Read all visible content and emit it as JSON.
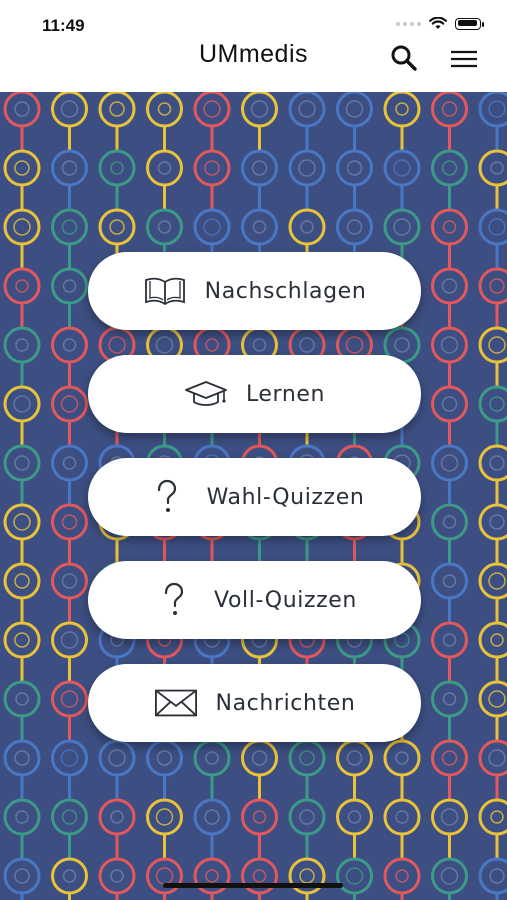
{
  "status_bar": {
    "time": "11:49"
  },
  "nav": {
    "title": "UMmedis"
  },
  "menu": [
    {
      "label": "Nachschlagen",
      "icon": "book-icon"
    },
    {
      "label": "Lernen",
      "icon": "graduation-cap-icon"
    },
    {
      "label": "Wahl-Quizzen",
      "icon": "question-mark-icon"
    },
    {
      "label": "Voll-Quizzen",
      "icon": "question-mark-icon"
    },
    {
      "label": "Nachrichten",
      "icon": "envelope-icon"
    }
  ],
  "colors": {
    "pattern_background": "#3d4f82",
    "ring_yellow": "#e8c33a",
    "ring_red": "#e2585c",
    "ring_green": "#3c9a86",
    "ring_blue": "#4a77c4",
    "button_background": "#ffffff"
  }
}
